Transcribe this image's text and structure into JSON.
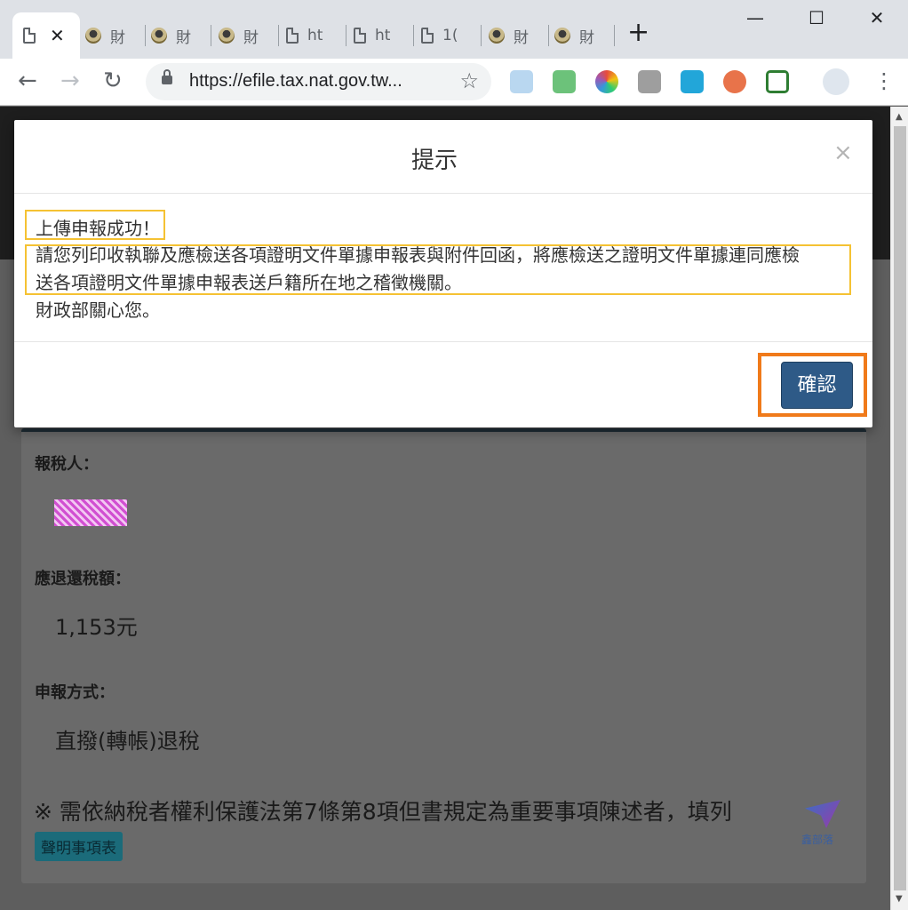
{
  "browser": {
    "tabs": [
      {
        "label": "",
        "icon": "doc-icon",
        "active": true
      },
      {
        "label": "財",
        "icon": "seal-icon"
      },
      {
        "label": "財",
        "icon": "seal-icon"
      },
      {
        "label": "財",
        "icon": "seal-icon"
      },
      {
        "label": "ht",
        "icon": "doc-icon"
      },
      {
        "label": "ht",
        "icon": "doc-icon"
      },
      {
        "label": "1(",
        "icon": "doc-icon"
      },
      {
        "label": "財",
        "icon": "seal-icon"
      },
      {
        "label": "財",
        "icon": "seal-icon"
      }
    ],
    "url": "https://efile.tax.nat.gov.tw...",
    "extensions": [
      "ext-1",
      "ext-2",
      "ext-3",
      "ext-4",
      "ext-5",
      "ext-6",
      "ext-7"
    ]
  },
  "modal": {
    "title": "提示",
    "close_label": "×",
    "line1": "上傳申報成功！",
    "line2": "請您列印收執聯及應檢送各項證明文件單據申報表與附件回函，將應檢送之證明文件單據連同應檢",
    "line3": "送各項證明文件單據申報表送戶籍所在地之稽徵機關。",
    "line4": "財政部關心您。",
    "confirm_label": "確認"
  },
  "page": {
    "taxpayer_label": "報稅人：",
    "refund_label": "應退還稅額：",
    "refund_value": "1,153元",
    "method_label": "申報方式：",
    "method_value": "直撥(轉帳)退稅",
    "notice": "※ 需依納稅者權利保護法第7條第8項但書規定為重要事項陳述者，填列",
    "declare_button": "聲明事項表",
    "watermark": "鑫部落"
  },
  "colors": {
    "confirm_button": "#2e5a87",
    "highlight_yellow": "#f5c233",
    "highlight_orange": "#f07a1a"
  }
}
